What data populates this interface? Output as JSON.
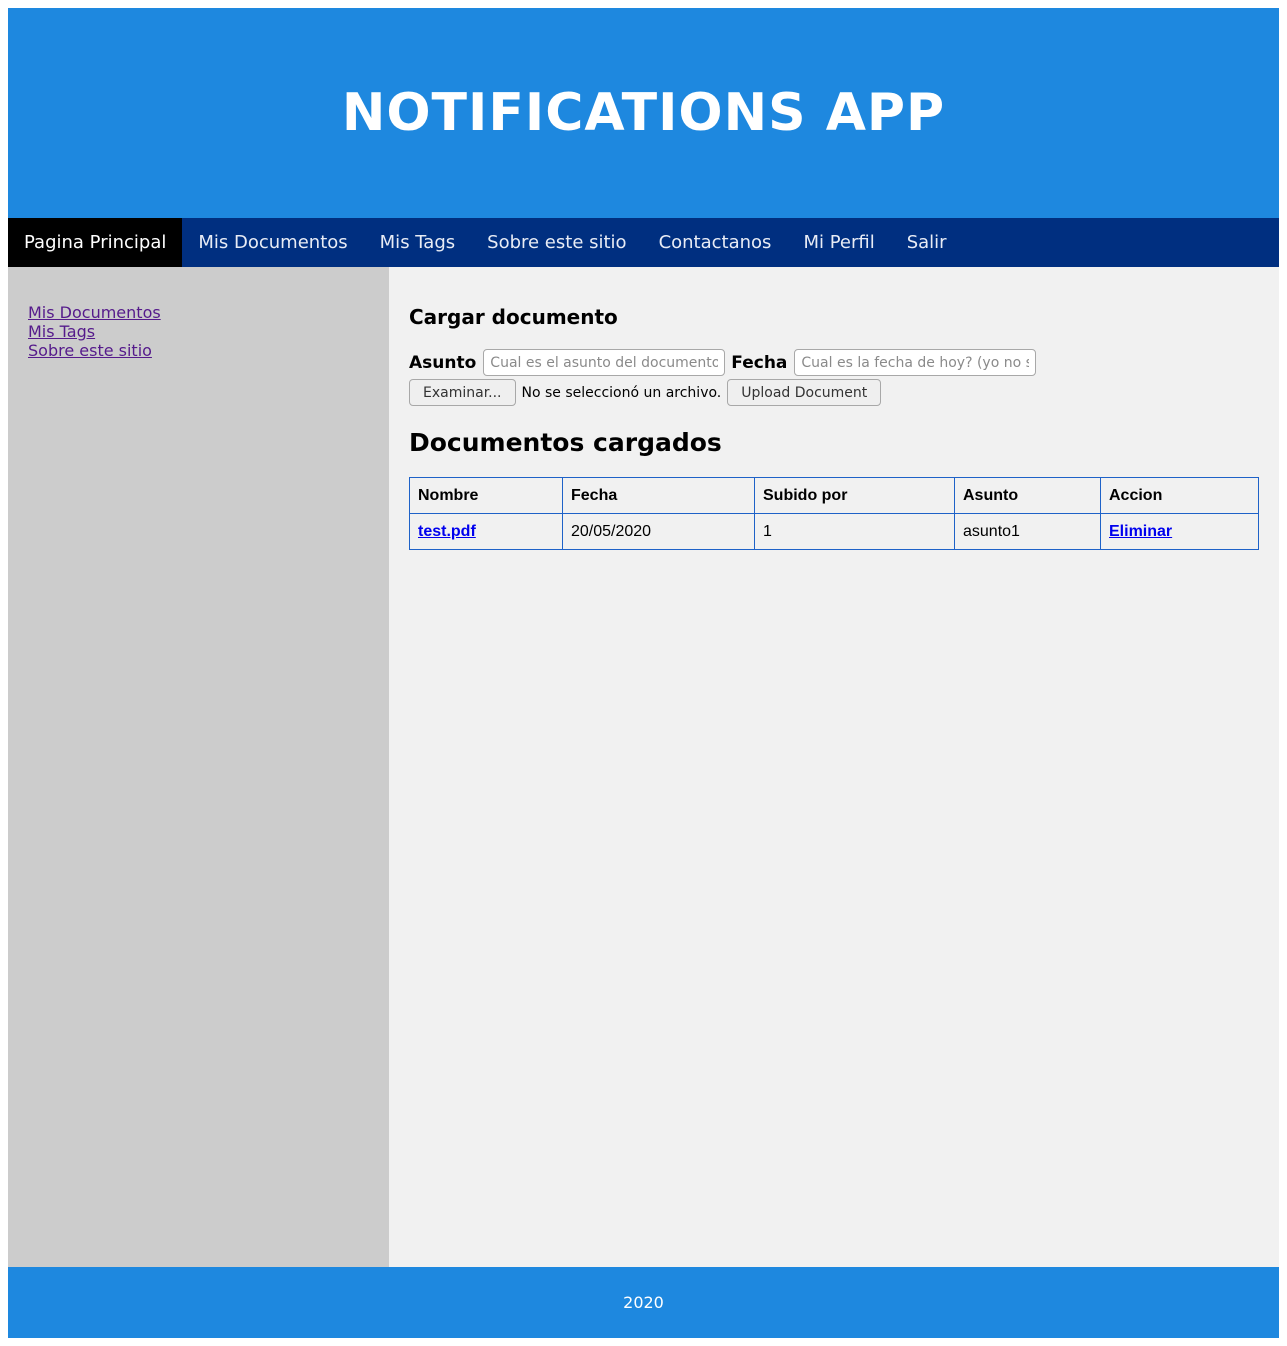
{
  "header": {
    "title": "NOTIFICATIONS APP"
  },
  "nav": {
    "items": [
      {
        "label": "Pagina Principal"
      },
      {
        "label": "Mis Documentos"
      },
      {
        "label": "Mis Tags"
      },
      {
        "label": "Sobre este sitio"
      },
      {
        "label": "Contactanos"
      },
      {
        "label": "Mi Perfil"
      },
      {
        "label": "Salir"
      }
    ],
    "active": "Pagina Principal"
  },
  "sidebar": {
    "links": [
      {
        "label": "Mis Documentos"
      },
      {
        "label": "Mis Tags"
      },
      {
        "label": "Sobre este sitio"
      }
    ]
  },
  "upload": {
    "title": "Cargar documento",
    "asunto_label": "Asunto",
    "asunto_placeholder": "Cual es el asunto del documento?",
    "fecha_label": "Fecha",
    "fecha_placeholder": "Cual es la fecha de hoy? (yo no se)",
    "browse_label": "Examinar...",
    "no_file_text": "No se seleccionó un archivo.",
    "upload_label": "Upload Document"
  },
  "documents": {
    "title": "Documentos cargados",
    "columns": [
      "Nombre",
      "Fecha",
      "Subido por",
      "Asunto",
      "Accion"
    ],
    "rows": [
      {
        "nombre": "test.pdf",
        "fecha": "20/05/2020",
        "subido_por": "1",
        "asunto": "asunto1",
        "accion": "Eliminar"
      }
    ]
  },
  "footer": {
    "text": "2020"
  },
  "colors": {
    "header": "#1e88df",
    "nav": "#002f80",
    "nav_active": "#000000",
    "sidebar": "#cccccc",
    "main": "#f1f1f1",
    "table_border": "#1e62c8"
  }
}
